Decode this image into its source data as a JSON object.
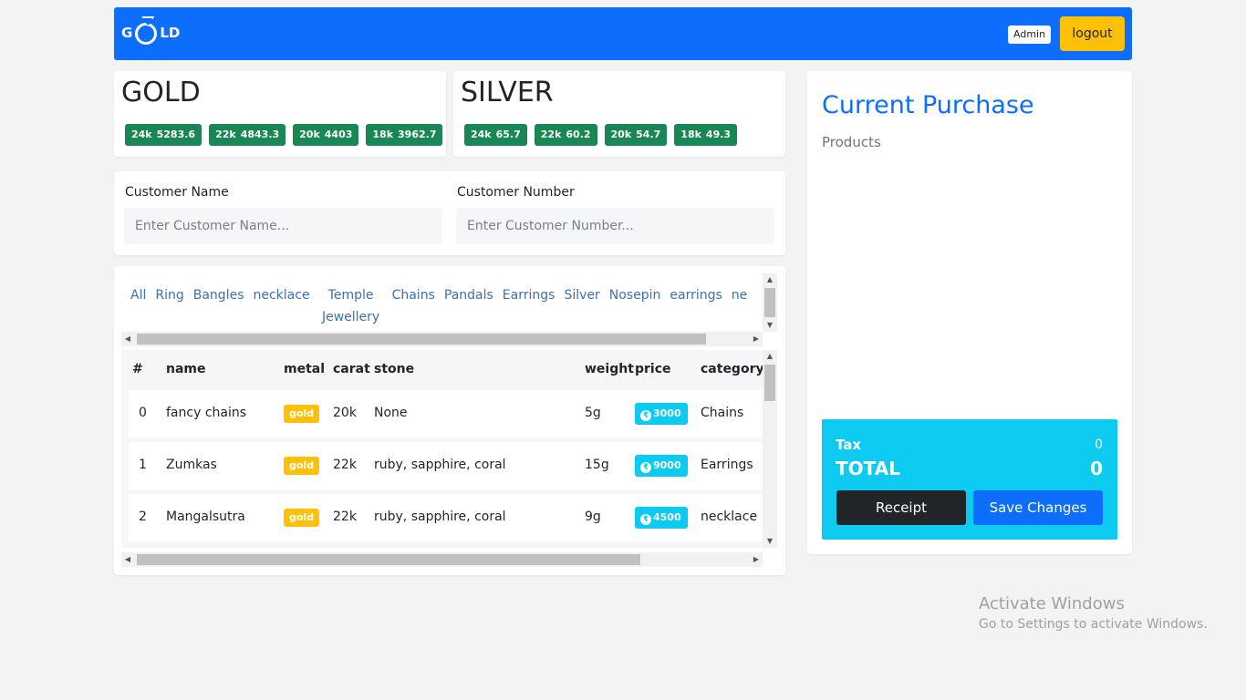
{
  "navbar": {
    "logo_left": "G",
    "logo_right": "LD",
    "admin_label": "Admin",
    "logout_label": "logout",
    "color": "#0d6efd"
  },
  "rates": {
    "gold": {
      "title": "GOLD",
      "items": [
        {
          "carat": "24k",
          "price": "5283.6"
        },
        {
          "carat": "22k",
          "price": "4843.3"
        },
        {
          "carat": "20k",
          "price": "4403"
        },
        {
          "carat": "18k",
          "price": "3962.7"
        }
      ]
    },
    "silver": {
      "title": "SILVER",
      "items": [
        {
          "carat": "24k",
          "price": "65.7"
        },
        {
          "carat": "22k",
          "price": "60.2"
        },
        {
          "carat": "20k",
          "price": "54.7"
        },
        {
          "carat": "18k",
          "price": "49.3"
        }
      ]
    }
  },
  "customer": {
    "name_label": "Customer Name",
    "name_placeholder": "Enter Customer Name...",
    "number_label": "Customer Number",
    "number_placeholder": "Enter Customer Number..."
  },
  "categories": [
    "All",
    "Ring",
    "Bangles",
    "necklace",
    "Temple Jewellery",
    "Chains",
    "Pandals",
    "Earrings",
    "Silver",
    "Nosepin",
    "earrings",
    "ne"
  ],
  "table": {
    "headers": [
      "#",
      "name",
      "metal",
      "carat",
      "stone",
      "weight",
      "price",
      "category"
    ],
    "rows": [
      {
        "index": "0",
        "name": "fancy chains",
        "metal": "gold",
        "carat": "20k",
        "stone": "None",
        "weight": "5g",
        "price": "3000",
        "category": "Chains"
      },
      {
        "index": "1",
        "name": "Zumkas",
        "metal": "gold",
        "carat": "22k",
        "stone": "ruby, sapphire, coral",
        "weight": "15g",
        "price": "9000",
        "category": "Earrings"
      },
      {
        "index": "2",
        "name": "Mangalsutra",
        "metal": "gold",
        "carat": "22k",
        "stone": "ruby, sapphire, coral",
        "weight": "9g",
        "price": "4500",
        "category": "necklace"
      }
    ]
  },
  "purchase": {
    "title": "Current Purchase",
    "products_label": "Products",
    "tax_label": "Tax",
    "tax_value": "0",
    "total_label": "TOTAL",
    "total_value": "0",
    "receipt_label": "Receipt",
    "save_label": "Save Changes"
  },
  "watermark": {
    "title": "Activate Windows",
    "subtitle": "Go to Settings to activate Windows."
  },
  "colors": {
    "primary": "#0d6efd",
    "success": "#198754",
    "warning": "#ffc107",
    "info": "#0dcaf0",
    "dark": "#212529"
  }
}
